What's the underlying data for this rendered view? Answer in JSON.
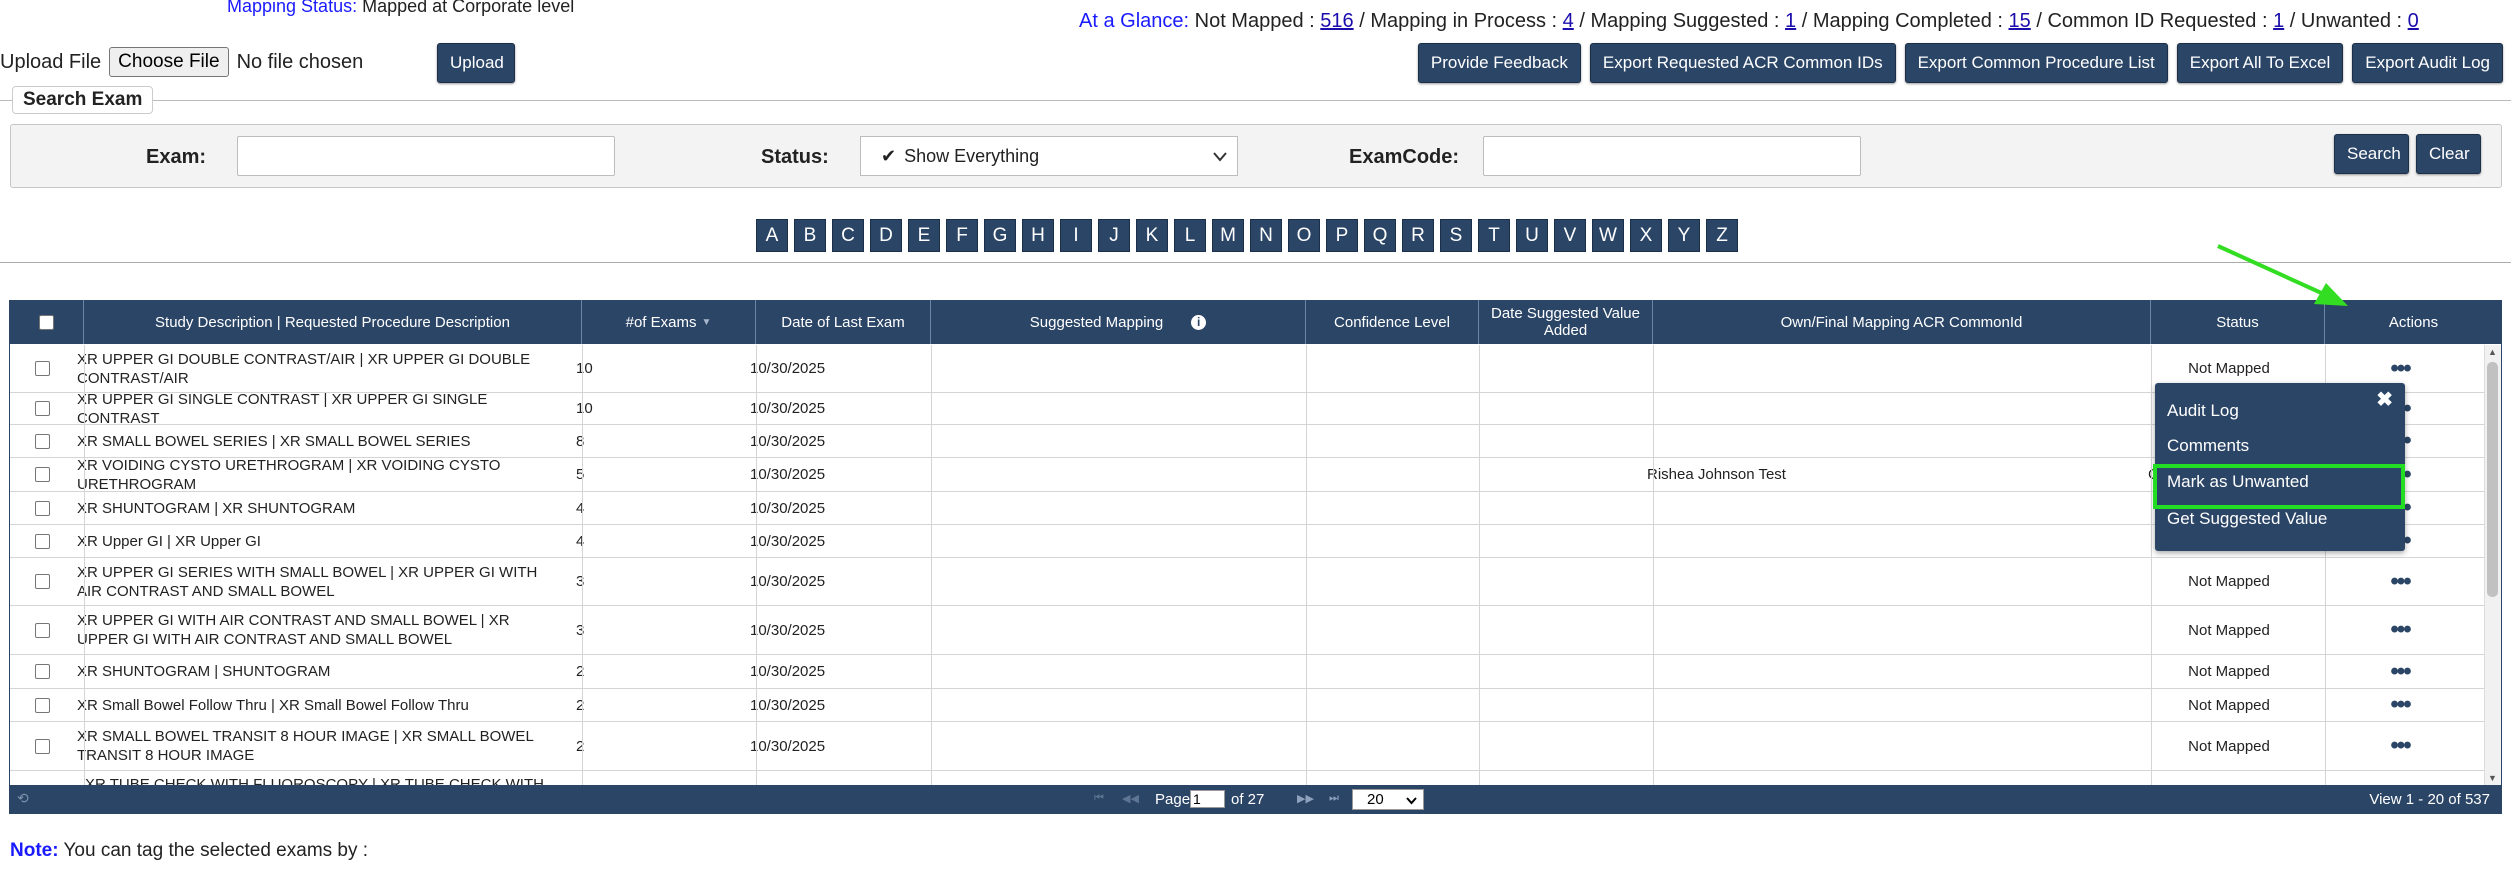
{
  "header": {
    "mapping_status_label": "Mapping Status:",
    "mapping_status_value": "Mapped at Corporate level",
    "glance": {
      "label": "At a Glance:",
      "not_mapped_text": "Not Mapped :",
      "not_mapped": "516",
      "in_process_text": "/ Mapping in Process :",
      "in_process": "4",
      "suggested_text": "/ Mapping Suggested :",
      "suggested": "1",
      "completed_text": "/ Mapping Completed :",
      "completed": "15",
      "common_id_text": "/ Common ID Requested :",
      "common_id": "1",
      "unwanted_text": "/ Unwanted :",
      "unwanted": "0"
    }
  },
  "upload": {
    "label": "Upload File",
    "choose_label": "Choose File",
    "no_file": "No file chosen",
    "upload_label": "Upload"
  },
  "toolbar": {
    "feedback": "Provide Feedback",
    "export_acr": "Export Requested ACR Common IDs",
    "export_common": "Export Common Procedure List",
    "export_all": "Export All To Excel",
    "export_audit": "Export Audit Log"
  },
  "search": {
    "legend": "Search Exam",
    "exam_label": "Exam:",
    "exam_value": "",
    "status_label": "Status:",
    "status_value": "Show Everything",
    "examcode_label": "ExamCode:",
    "examcode_value": "",
    "search_label": "Search",
    "clear_label": "Clear"
  },
  "alphabet": [
    "A",
    "B",
    "C",
    "D",
    "E",
    "F",
    "G",
    "H",
    "I",
    "J",
    "K",
    "L",
    "M",
    "N",
    "O",
    "P",
    "Q",
    "R",
    "S",
    "T",
    "U",
    "V",
    "W",
    "X",
    "Y",
    "Z"
  ],
  "grid": {
    "columns": {
      "study": "Study Description | Requested Procedure Description",
      "exams": "#of Exams",
      "last": "Date of Last Exam",
      "suggested": "Suggested Mapping",
      "confidence": "Confidence Level",
      "date_suggested": "Date Suggested Value Added",
      "final": "Own/Final Mapping ACR CommonId",
      "status": "Status",
      "actions": "Actions"
    },
    "rows": [
      {
        "study": "XR UPPER GI DOUBLE CONTRAST/AIR | XR UPPER GI DOUBLE CONTRAST/AIR",
        "exams": "10",
        "date": "10/30/2025",
        "final": "",
        "status": "Not Mapped"
      },
      {
        "study": "XR UPPER GI SINGLE CONTRAST | XR UPPER GI SINGLE CONTRAST",
        "exams": "10",
        "date": "10/30/2025",
        "final": "",
        "status": ""
      },
      {
        "study": "XR SMALL BOWEL SERIES | XR SMALL BOWEL SERIES",
        "exams": "8",
        "date": "10/30/2025",
        "final": "",
        "status": ""
      },
      {
        "study": "XR VOIDING CYSTO URETHROGRAM | XR VOIDING CYSTO URETHROGRAM",
        "exams": "5",
        "date": "10/30/2025",
        "final": "Rishea Johnson Test",
        "status": "C"
      },
      {
        "study": "XR SHUNTOGRAM | XR SHUNTOGRAM",
        "exams": "4",
        "date": "10/30/2025",
        "final": "",
        "status": ""
      },
      {
        "study": "XR Upper GI | XR Upper GI",
        "exams": "4",
        "date": "10/30/2025",
        "final": "",
        "status": ""
      },
      {
        "study": "XR UPPER GI SERIES WITH SMALL BOWEL | XR UPPER GI WITH AIR CONTRAST AND SMALL BOWEL",
        "exams": "3",
        "date": "10/30/2025",
        "final": "",
        "status": "Not Mapped"
      },
      {
        "study": "XR UPPER GI WITH AIR CONTRAST AND SMALL BOWEL | XR UPPER GI WITH AIR CONTRAST AND SMALL BOWEL",
        "exams": "3",
        "date": "10/30/2025",
        "final": "",
        "status": "Not Mapped"
      },
      {
        "study": "XR SHUNTOGRAM | SHUNTOGRAM",
        "exams": "2",
        "date": "10/30/2025",
        "final": "",
        "status": "Not Mapped"
      },
      {
        "study": "XR Small Bowel Follow Thru | XR Small Bowel Follow Thru",
        "exams": "2",
        "date": "10/30/2025",
        "final": "",
        "status": "Not Mapped"
      },
      {
        "study": "XR SMALL BOWEL TRANSIT 8 HOUR IMAGE | XR SMALL BOWEL TRANSIT 8 HOUR IMAGE",
        "exams": "2",
        "date": "10/30/2025",
        "final": "",
        "status": "Not Mapped"
      }
    ],
    "partial_row": "XR TUBE CHECK WITH FLUOROSCOPY | XR TUBE CHECK WITH"
  },
  "pager": {
    "page_label": "Page",
    "page_value": "1",
    "of_label": "of 27",
    "rows_value": "20",
    "view_text": "View 1 - 20 of 537"
  },
  "menu": {
    "audit": "Audit Log",
    "comments": "Comments",
    "unwanted": "Mark as Unwanted",
    "suggested": "Get Suggested Value"
  },
  "note": {
    "label": "Note:",
    "text": "You can tag the selected exams by :"
  },
  "colors": {
    "navy": "#2b4567",
    "highlight": "#22dd22",
    "arrow": "#33dd22"
  }
}
